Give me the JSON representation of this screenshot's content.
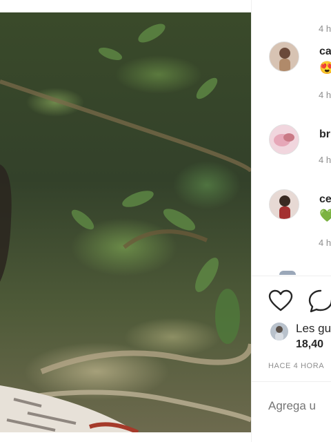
{
  "post": {
    "photo_alt": "",
    "comments": [
      {
        "time": "4 h"
      },
      {
        "user": "ca",
        "emoji": "😍",
        "time": "4 h"
      },
      {
        "user": "br",
        "time": "4 h"
      },
      {
        "user": "ce",
        "emoji": "💚",
        "time": "4 h"
      }
    ],
    "actions": {
      "like_icon": "heart-icon",
      "comment_icon": "comment-bubble-icon"
    },
    "likes_prefix": "Les gu",
    "likes_count": "18,40",
    "date": "HACE 4 HORA",
    "comment_placeholder": "Agrega u"
  },
  "colors": {
    "text": "#262626",
    "muted": "#8e8e8e",
    "divider": "#efefef"
  }
}
